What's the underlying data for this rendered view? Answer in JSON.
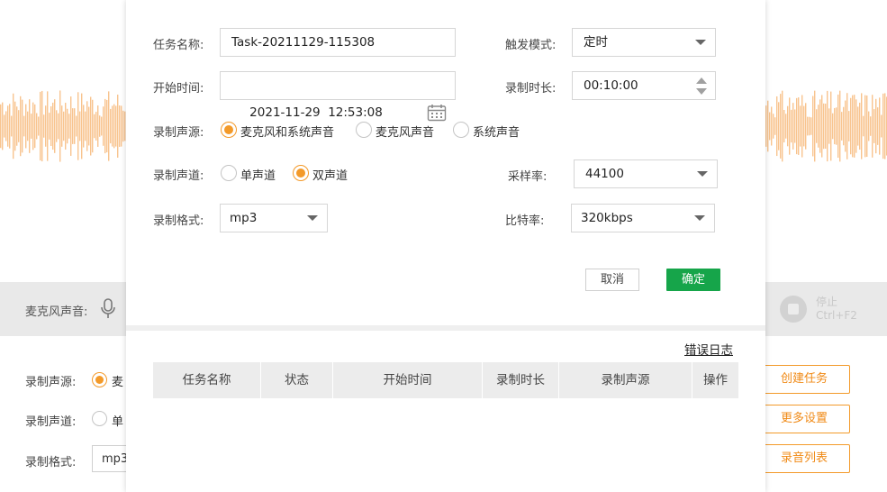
{
  "background": {
    "mic_label": "麦克风声音:",
    "stop_label": "停止",
    "stop_shortcut": "Ctrl+F2",
    "source_label": "录制声源:",
    "source_option": "麦",
    "channel_label": "录制声道:",
    "channel_option": "单",
    "format_label": "录制格式:",
    "format_value": "mp3",
    "buttons": {
      "create_task": "创建任务",
      "more_settings": "更多设置",
      "recording_list": "录音列表"
    },
    "wave_color": "#f8c48f"
  },
  "dialog": {
    "task_name": {
      "label": "任务名称:",
      "value": "Task-20211129-115308"
    },
    "trigger_mode": {
      "label": "触发模式:",
      "value": "定时"
    },
    "start_time": {
      "label": "开始时间:",
      "value": "2021-11-29  12:53:08"
    },
    "duration": {
      "label": "录制时长:",
      "value": "00:10:00"
    },
    "source": {
      "label": "录制声源:",
      "options": [
        "麦克风和系统声音",
        "麦克风声音",
        "系统声音"
      ],
      "selected_index": 0
    },
    "channel": {
      "label": "录制声道:",
      "options": [
        "单声道",
        "双声道"
      ],
      "selected_index": 1
    },
    "sample_rate": {
      "label": "采样率:",
      "value": "44100"
    },
    "format": {
      "label": "录制格式:",
      "value": "mp3"
    },
    "bitrate": {
      "label": "比特率:",
      "value": "320kbps"
    },
    "cancel_label": "取消",
    "ok_label": "确定",
    "error_log_label": "错误日志",
    "table": {
      "columns": [
        "任务名称",
        "状态",
        "开始时间",
        "录制时长",
        "录制声源",
        "操作"
      ]
    }
  },
  "colors": {
    "accent_orange": "#f39a2a",
    "confirm_green": "#16a54a"
  },
  "icons": {
    "calendar": "calendar-icon",
    "microphone": "microphone-icon",
    "stop": "stop-icon"
  }
}
